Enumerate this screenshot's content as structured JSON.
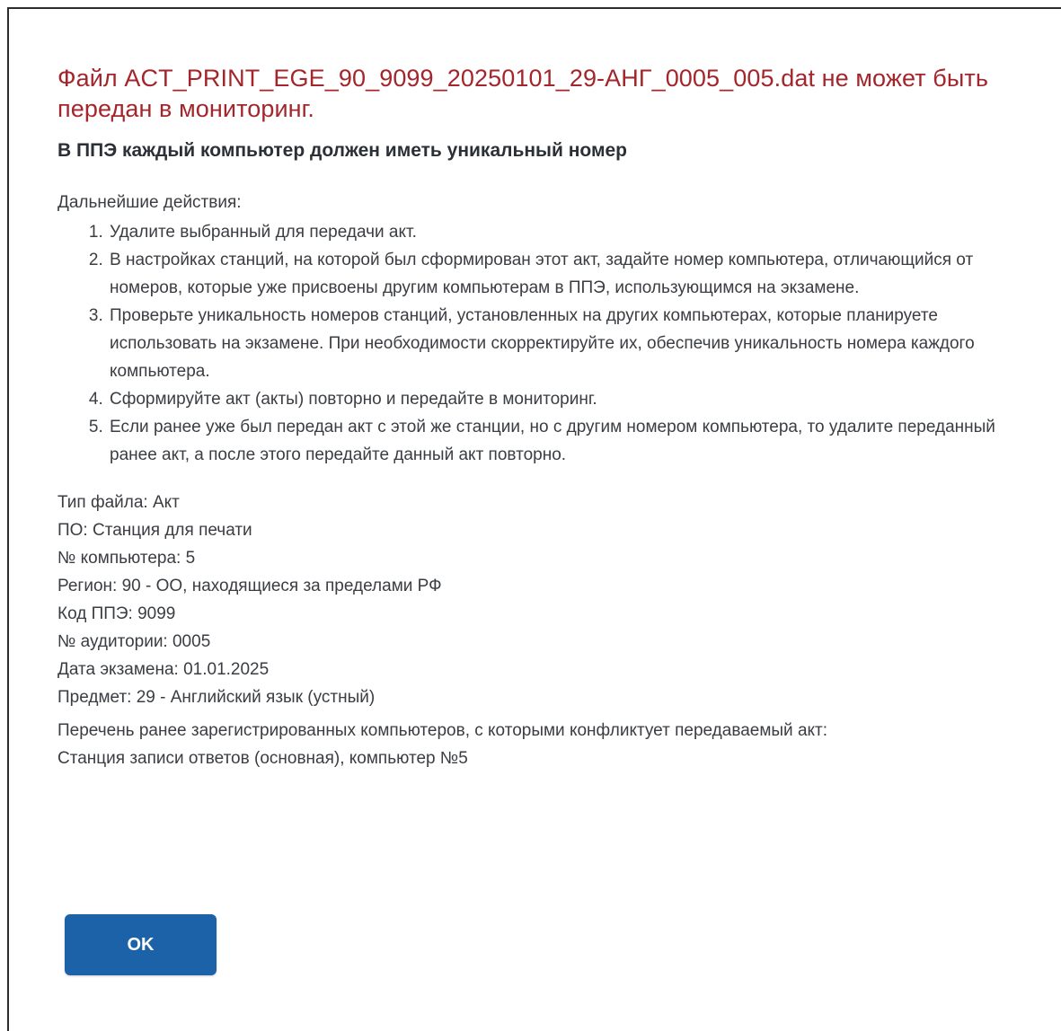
{
  "dialog": {
    "error_title": "Файл ACT_PRINT_EGE_90_9099_20250101_29-АНГ_0005_005.dat не может быть передан в мониторинг.",
    "subtitle": "В ППЭ каждый компьютер должен иметь уникальный номер",
    "next_steps_label": "Дальнейшие действия:",
    "steps": [
      "Удалите выбранный для передачи акт.",
      "В настройках станций, на которой был сформирован этот акт, задайте номер компьютера, отличающийся от номеров, которые уже присвоены другим компьютерам в ППЭ, использующимся на экзамене.",
      "Проверьте уникальность номеров станций, установленных на других компьютерах, которые планируете использовать на экзамене. При необходимости скорректируйте их, обеспечив уникальность номера каждого компьютера.",
      "Сформируйте акт (акты) повторно и передайте в мониторинг.",
      "Если ранее уже был передан акт с этой же станции, но с другим номером компьютера, то удалите переданный ранее акт, а после этого передайте данный акт повторно."
    ],
    "meta": {
      "file_type": "Тип файла: Акт",
      "software": "ПО: Станция для печати",
      "computer_number": "№ компьютера: 5",
      "region": "Регион: 90 - ОО, находящиеся за пределами РФ",
      "ppe_code": "Код ППЭ: 9099",
      "auditorium": "№ аудитории: 0005",
      "exam_date": "Дата экзамена: 01.01.2025",
      "subject": "Предмет: 29 - Английский язык (устный)"
    },
    "conflicts_label": "Перечень ранее зарегистрированных компьютеров, с которыми конфликтует передаваемый акт:",
    "conflicts_list": "Станция записи ответов (основная), компьютер №5",
    "ok_label": "OK"
  },
  "colors": {
    "error_title": "#a3262c",
    "primary_button": "#1c62a8",
    "text": "#3a3d42"
  }
}
